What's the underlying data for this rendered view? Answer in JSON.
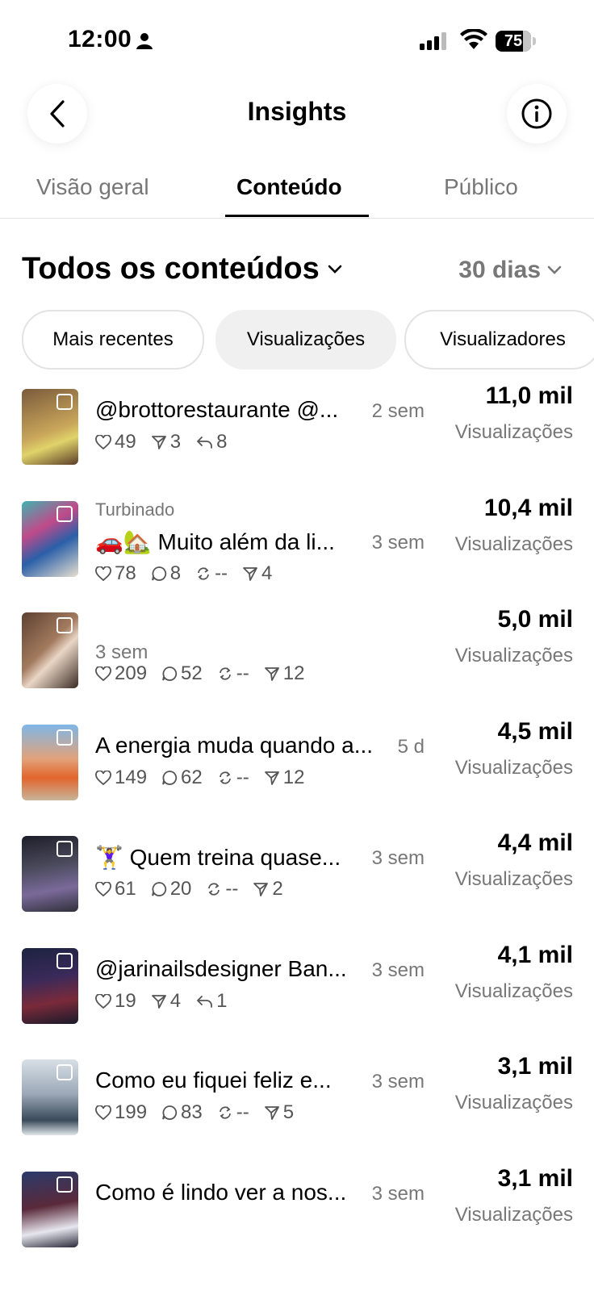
{
  "status_bar": {
    "time": "12:00",
    "battery": "75"
  },
  "header": {
    "title": "Insights"
  },
  "tabs": [
    "Visão geral",
    "Conteúdo",
    "Público"
  ],
  "filters": {
    "content_title": "Todos os conteúdos",
    "period": "30 dias"
  },
  "chips": [
    "Mais recentes",
    "Visualizações",
    "Visualizadores"
  ],
  "posts": [
    {
      "label": "",
      "caption": "@brottorestaurante  @...",
      "age": "2 sem",
      "likes": "49",
      "comments": "",
      "reposts": "",
      "shares": "3",
      "replies": "8",
      "value": "11,0 mil",
      "value_label": "Visualizações"
    },
    {
      "label": "Turbinado",
      "caption": "🚗🏡 Muito além da li...",
      "age": "3 sem",
      "likes": "78",
      "comments": "8",
      "reposts": "--",
      "shares": "4",
      "replies": "",
      "value": "10,4 mil",
      "value_label": "Visualizações"
    },
    {
      "label": "",
      "caption": "",
      "age": "3 sem",
      "likes": "209",
      "comments": "52",
      "reposts": "--",
      "shares": "12",
      "replies": "",
      "value": "5,0 mil",
      "value_label": "Visualizações"
    },
    {
      "label": "",
      "caption": "A energia muda quando a...",
      "age": "5 d",
      "likes": "149",
      "comments": "62",
      "reposts": "--",
      "shares": "12",
      "replies": "",
      "value": "4,5 mil",
      "value_label": "Visualizações"
    },
    {
      "label": "",
      "caption": "🏋️‍♀️ Quem treina quase...",
      "age": "3 sem",
      "likes": "61",
      "comments": "20",
      "reposts": "--",
      "shares": "2",
      "replies": "",
      "value": "4,4 mil",
      "value_label": "Visualizações"
    },
    {
      "label": "",
      "caption": "@jarinailsdesigner  Ban...",
      "age": "3 sem",
      "likes": "19",
      "comments": "",
      "reposts": "",
      "shares": "4",
      "replies": "1",
      "value": "4,1 mil",
      "value_label": "Visualizações"
    },
    {
      "label": "",
      "caption": "Como eu fiquei feliz e...",
      "age": "3 sem",
      "likes": "199",
      "comments": "83",
      "reposts": "--",
      "shares": "5",
      "replies": "",
      "value": "3,1 mil",
      "value_label": "Visualizações"
    },
    {
      "label": "",
      "caption": "Como é lindo ver a nos...",
      "age": "3 sem",
      "likes": "",
      "comments": "",
      "reposts": "",
      "shares": "",
      "replies": "",
      "value": "3,1 mil",
      "value_label": "Visualizações"
    }
  ]
}
